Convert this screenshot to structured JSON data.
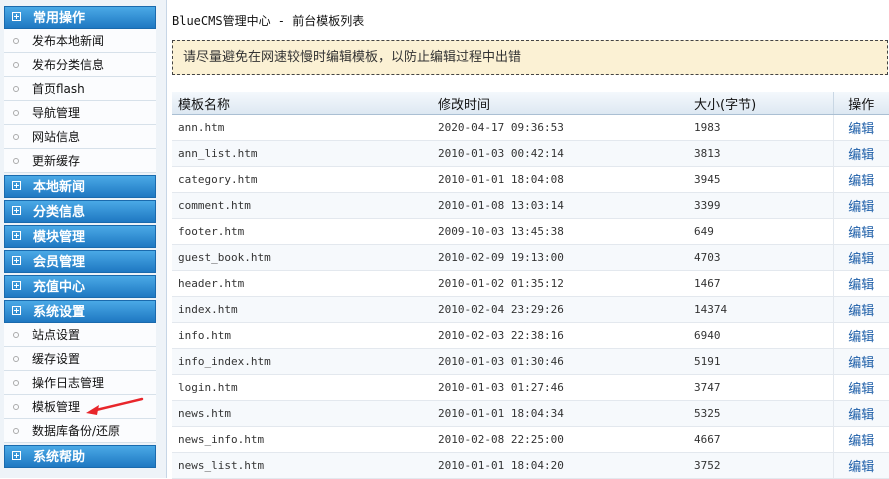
{
  "sidebar": {
    "sections": [
      {
        "label": "常用操作",
        "items": [
          "发布本地新闻",
          "发布分类信息",
          "首页flash",
          "导航管理",
          "网站信息",
          "更新缓存"
        ]
      },
      {
        "label": "本地新闻",
        "items": []
      },
      {
        "label": "分类信息",
        "items": []
      },
      {
        "label": "模块管理",
        "items": []
      },
      {
        "label": "会员管理",
        "items": []
      },
      {
        "label": "充值中心",
        "items": []
      },
      {
        "label": "系统设置",
        "items": [
          "站点设置",
          "缓存设置",
          "操作日志管理",
          "模板管理",
          "数据库备份/还原"
        ]
      },
      {
        "label": "系统帮助",
        "items": []
      }
    ]
  },
  "main": {
    "title": "BlueCMS管理中心 - 前台模板列表",
    "tip": "请尽量避免在网速较慢时编辑模板，以防止编辑过程中出错",
    "columns": [
      "模板名称",
      "修改时间",
      "大小(字节)",
      "操作"
    ],
    "rows": [
      {
        "name": "ann.htm",
        "time": "2020-04-17 09:36:53",
        "size": "1983",
        "action": "编辑"
      },
      {
        "name": "ann_list.htm",
        "time": "2010-01-03 00:42:14",
        "size": "3813",
        "action": "编辑"
      },
      {
        "name": "category.htm",
        "time": "2010-01-01 18:04:08",
        "size": "3945",
        "action": "编辑"
      },
      {
        "name": "comment.htm",
        "time": "2010-01-08 13:03:14",
        "size": "3399",
        "action": "编辑"
      },
      {
        "name": "footer.htm",
        "time": "2009-10-03 13:45:38",
        "size": "649",
        "action": "编辑"
      },
      {
        "name": "guest_book.htm",
        "time": "2010-02-09 19:13:00",
        "size": "4703",
        "action": "编辑"
      },
      {
        "name": "header.htm",
        "time": "2010-01-02 01:35:12",
        "size": "1467",
        "action": "编辑"
      },
      {
        "name": "index.htm",
        "time": "2010-02-04 23:29:26",
        "size": "14374",
        "action": "编辑"
      },
      {
        "name": "info.htm",
        "time": "2010-02-03 22:38:16",
        "size": "6940",
        "action": "编辑"
      },
      {
        "name": "info_index.htm",
        "time": "2010-01-03 01:30:46",
        "size": "5191",
        "action": "编辑"
      },
      {
        "name": "login.htm",
        "time": "2010-01-03 01:27:46",
        "size": "3747",
        "action": "编辑"
      },
      {
        "name": "news.htm",
        "time": "2010-01-01 18:04:34",
        "size": "5325",
        "action": "编辑"
      },
      {
        "name": "news_info.htm",
        "time": "2010-02-08 22:25:00",
        "size": "4667",
        "action": "编辑"
      },
      {
        "name": "news_list.htm",
        "time": "2010-01-01 18:04:20",
        "size": "3752",
        "action": "编辑"
      }
    ]
  },
  "colors": {
    "accent": "#1f78c2",
    "tip_bg": "#fbf1d4",
    "link": "#1d5ea8",
    "arrow": "#e8262b"
  }
}
